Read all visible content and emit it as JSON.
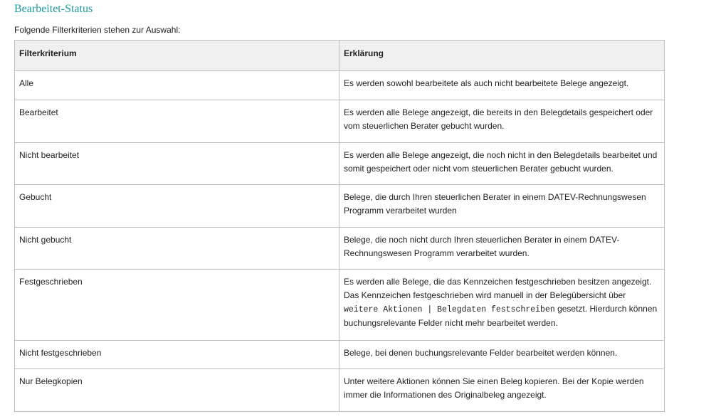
{
  "heading": "Bearbeitet-Status",
  "intro": "Folgende Filterkriterien stehen zur Auswahl:",
  "table": {
    "headers": [
      "Filterkriterium",
      "Erklärung"
    ],
    "rows": [
      {
        "criterion": "Alle",
        "explanation": "Es werden sowohl bearbeitete als auch nicht bearbeitete Belege angezeigt."
      },
      {
        "criterion": "Bearbeitet",
        "explanation": "Es werden alle Belege angezeigt, die bereits in den Belegdetails gespeichert oder vom steuerlichen Berater gebucht wurden."
      },
      {
        "criterion": "Nicht bearbeitet",
        "explanation": "Es werden alle Belege angezeigt, die noch nicht in den Belegdetails bearbeitet und somit gespeichert oder nicht vom steuerlichen Berater gebucht wurden."
      },
      {
        "criterion": "Gebucht",
        "explanation": "Belege, die durch Ihren steuerlichen Berater in einem DATEV-Rechnungswesen Programm verarbeitet wurden"
      },
      {
        "criterion": "Nicht gebucht",
        "explanation": "Belege, die noch nicht durch Ihren steuerlichen Berater in einem DATEV-Rechnungswesen Programm verarbeitet wurden."
      },
      {
        "criterion": "Festgeschrieben",
        "explanation_pre": "Es werden alle Belege, die das Kennzeichen festgeschrieben besitzen angezeigt. Das Kennzeichen festgeschrieben wird manuell in der Belegübersicht über ",
        "explanation_code": "weitere Aktionen | Belegdaten festschreiben",
        "explanation_post": " gesetzt. Hierdurch können buchungsrelevante Felder nicht mehr bearbeitet werden."
      },
      {
        "criterion": "Nicht festgeschrieben",
        "explanation": "Belege, bei denen buchungsrelevante Felder bearbeitet werden können."
      },
      {
        "criterion": "Nur Belegkopien",
        "explanation": "Unter weitere Aktionen können Sie einen Beleg kopieren. Bei der Kopie werden immer die Informationen des Originalbeleg angezeigt."
      }
    ]
  }
}
